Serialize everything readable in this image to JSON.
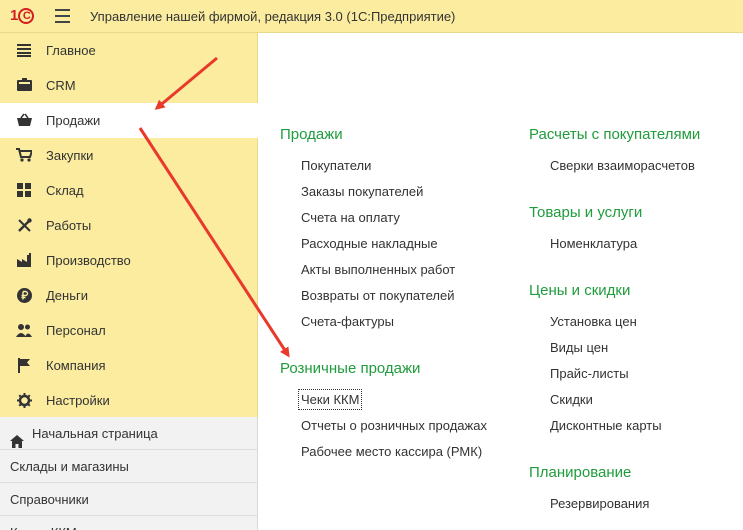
{
  "app": {
    "title": "Управление нашей фирмой, редакция 3.0  (1С:Предприятие)",
    "logo_text": "1С"
  },
  "sections": [
    {
      "label": "Главное",
      "icon": "list-icon"
    },
    {
      "label": "CRM",
      "icon": "crm-icon"
    },
    {
      "label": "Продажи",
      "icon": "basket-icon",
      "active": true
    },
    {
      "label": "Закупки",
      "icon": "cart-icon"
    },
    {
      "label": "Склад",
      "icon": "grid-icon"
    },
    {
      "label": "Работы",
      "icon": "tools-icon"
    },
    {
      "label": "Производство",
      "icon": "factory-icon"
    },
    {
      "label": "Деньги",
      "icon": "ruble-icon"
    },
    {
      "label": "Персонал",
      "icon": "people-icon"
    },
    {
      "label": "Компания",
      "icon": "flag-icon"
    },
    {
      "label": "Настройки",
      "icon": "gear-icon"
    }
  ],
  "lower_nav": [
    {
      "label": "Начальная страница",
      "icon": "home-icon"
    },
    {
      "label": "Склады и магазины"
    },
    {
      "label": "Справочники"
    },
    {
      "label": "Кассы ККМ"
    }
  ],
  "content": {
    "left": [
      {
        "title": "Продажи",
        "items": [
          "Покупатели",
          "Заказы покупателей",
          "Счета на оплату",
          "Расходные накладные",
          "Акты выполненных работ",
          "Возвраты от покупателей",
          "Счета-фактуры"
        ]
      },
      {
        "title": "Розничные продажи",
        "items": [
          "Чеки ККМ",
          "Отчеты о розничных продажах",
          "Рабочее место кассира (РМК)"
        ]
      }
    ],
    "right": [
      {
        "title": "Расчеты с покупателями",
        "items": [
          "Сверки взаиморасчетов"
        ]
      },
      {
        "title": "Товары и услуги",
        "items": [
          "Номенклатура"
        ]
      },
      {
        "title": "Цены и скидки",
        "items": [
          "Установка цен",
          "Виды цен",
          "Прайс-листы",
          "Скидки",
          "Дисконтные карты"
        ]
      },
      {
        "title": "Планирование",
        "items": [
          "Резервирования"
        ]
      }
    ]
  },
  "colors": {
    "sidebar": "#fbeca0",
    "group_title": "#1f9c3c",
    "arrow": "#e8392a"
  }
}
